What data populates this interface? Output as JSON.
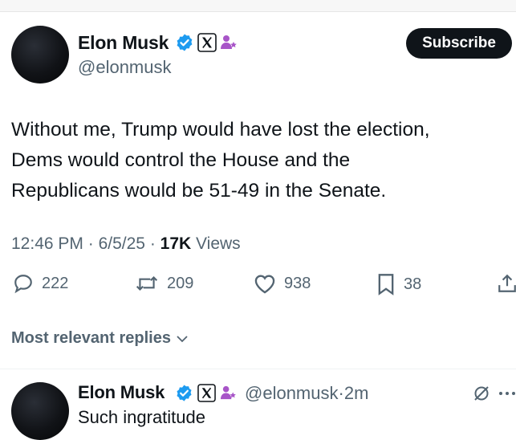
{
  "tweet": {
    "author_name": "Elon Musk",
    "author_handle": "@elonmusk",
    "subscribe_label": "Subscribe",
    "text_lines": [
      "Without me, Trump would have lost the election,",
      "Dems would control the House and the",
      "Republicans would be 51-49 in the Senate."
    ],
    "time": "12:46 PM",
    "date": "6/5/25",
    "views_count": "17K",
    "views_label": "Views",
    "separator": "·"
  },
  "actions": {
    "replies": "222",
    "reposts": "209",
    "likes": "938",
    "bookmarks": "38"
  },
  "replies_section": {
    "sort_label": "Most relevant replies"
  },
  "reply": {
    "author_name": "Elon Musk",
    "author_handle": "@elonmusk",
    "separator": "·",
    "time_ago": "2m",
    "text": "Such ingratitude"
  },
  "colors": {
    "verified_blue": "#1d9bf0",
    "affiliate_purple": "#a855c8",
    "muted_text": "#536471",
    "primary_text": "#0f1419"
  }
}
